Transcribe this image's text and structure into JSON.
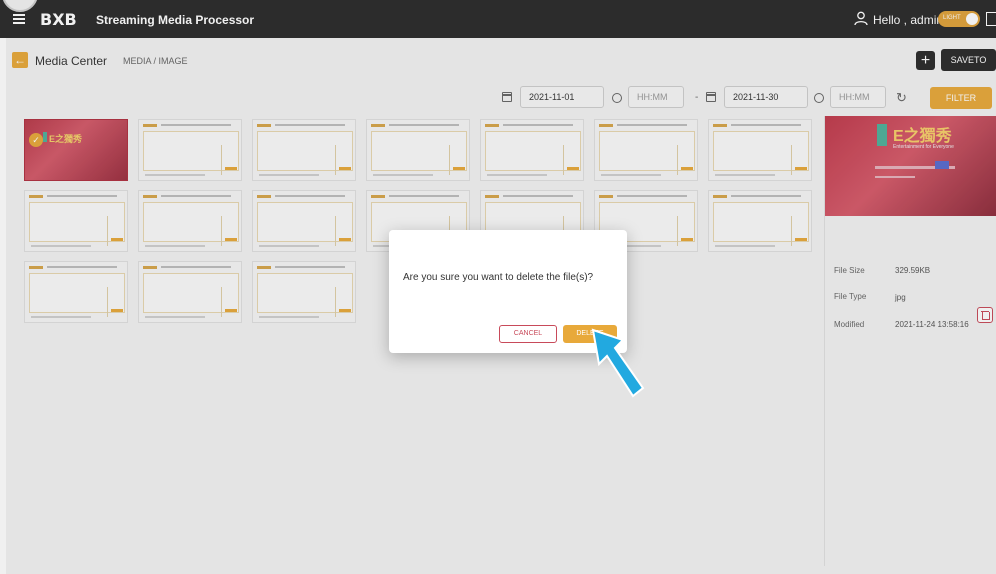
{
  "header": {
    "logo_text": "BXB",
    "app_title": "Streaming Media Processor",
    "greeting": "Hello , admin",
    "theme_toggle_label": "LIGHT"
  },
  "subheader": {
    "page_title": "Media Center",
    "breadcrumb": "MEDIA  /  IMAGE",
    "add_label": "+",
    "saveto_label": "SAVETO"
  },
  "filters": {
    "start_date": "2021-11-01",
    "start_time_placeholder": "HH:MM",
    "range_separator": "-",
    "end_date": "2021-11-30",
    "end_time_placeholder": "HH:MM",
    "filter_label": "FILTER"
  },
  "gallery": {
    "selected_thumb_title": "E之獨秀",
    "thumb_count": 17
  },
  "details": {
    "preview_title": "E之獨秀",
    "preview_subtitle": "Entertainment for Everyone",
    "file_size_label": "File Size",
    "file_size_value": "329.59KB",
    "file_type_label": "File Type",
    "file_type_value": "jpg",
    "modified_label": "Modified",
    "modified_value": "2021-11-24 13:58:16"
  },
  "dialog": {
    "message": "Are you sure you want to delete the file(s)?",
    "cancel_label": "CANCEL",
    "delete_label": "DELETE"
  },
  "colors": {
    "accent": "#e8a93a",
    "topbar": "#2b2b2b",
    "danger": "#c84a5a",
    "pointer": "#22a9e0"
  }
}
